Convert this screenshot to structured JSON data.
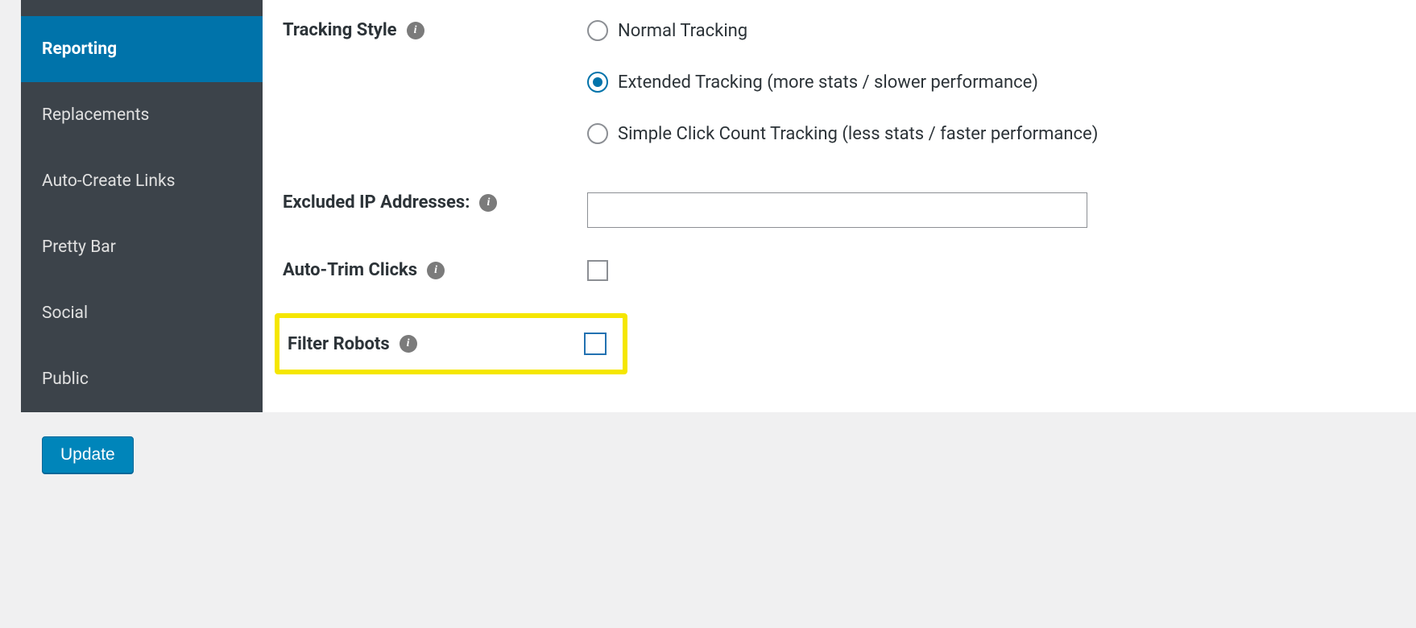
{
  "sidebar": {
    "items": [
      {
        "label": "Reporting",
        "active": true
      },
      {
        "label": "Replacements",
        "active": false
      },
      {
        "label": "Auto-Create Links",
        "active": false
      },
      {
        "label": "Pretty Bar",
        "active": false
      },
      {
        "label": "Social",
        "active": false
      },
      {
        "label": "Public",
        "active": false
      }
    ]
  },
  "form": {
    "tracking_style": {
      "label": "Tracking Style",
      "options": [
        {
          "value": "normal",
          "label": "Normal Tracking",
          "checked": false
        },
        {
          "value": "extended",
          "label": "Extended Tracking (more stats / slower performance)",
          "checked": true
        },
        {
          "value": "simple",
          "label": "Simple Click Count Tracking (less stats / faster performance)",
          "checked": false
        }
      ]
    },
    "excluded_ips": {
      "label": "Excluded IP Addresses:",
      "value": ""
    },
    "auto_trim": {
      "label": "Auto-Trim Clicks",
      "checked": false
    },
    "filter_robots": {
      "label": "Filter Robots",
      "checked": false
    }
  },
  "buttons": {
    "update": "Update"
  }
}
